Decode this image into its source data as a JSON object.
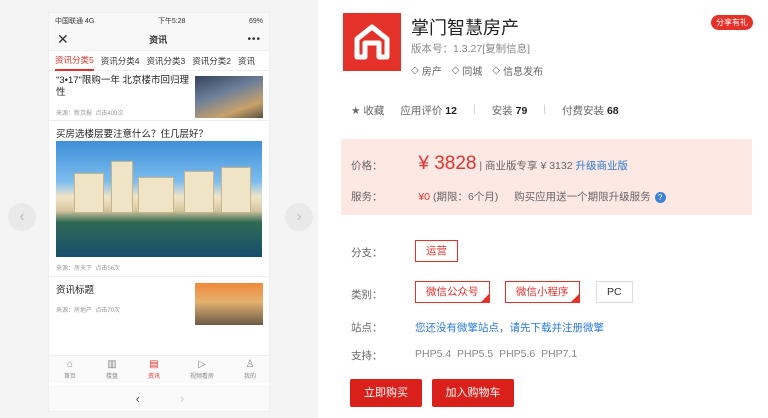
{
  "phone": {
    "status": {
      "carrier": "中国联通 4G",
      "time": "下午5:28",
      "battery": "69%"
    },
    "title": "资讯",
    "tabs": [
      "资讯分类5",
      "资讯分类4",
      "资讯分类3",
      "资讯分类2",
      "资讯"
    ],
    "news": [
      {
        "title": "\"3•17\"限购一年 北京楼市回归理性",
        "source": "来源：新京报",
        "clicks": "点击409次"
      },
      {
        "title": "买房选楼层要注意什么？住几层好？",
        "source": "来源：房天下",
        "clicks": "点击56次"
      },
      {
        "title": "资讯标题",
        "source": "来源：房地产",
        "clicks": "点击70次"
      }
    ],
    "tabbar": [
      {
        "label": "首页",
        "icon": "home-icon"
      },
      {
        "label": "楼盘",
        "icon": "building-icon"
      },
      {
        "label": "资讯",
        "icon": "news-icon"
      },
      {
        "label": "视频看房",
        "icon": "play-icon"
      },
      {
        "label": "我的",
        "icon": "user-icon"
      }
    ],
    "nav": {
      "back": "‹",
      "forward": "›"
    }
  },
  "app": {
    "name": "掌门智慧房产",
    "version": "版本号：1.3.27",
    "copy": "[复制信息]",
    "tags": [
      "房产",
      "同城",
      "信息发布"
    ],
    "share": "分享有礼",
    "stats": {
      "fav": "收藏",
      "rating_label": "应用评价",
      "rating": "12",
      "install_label": "安装",
      "install": "79",
      "paid_label": "付费安装",
      "paid": "68"
    },
    "price_label": "价格：",
    "price": "¥ 3828",
    "biz_text": "| 商业版专享 ¥ 3132",
    "upgrade": "升级商业版",
    "service_label": "服务：",
    "service_price": "¥0",
    "service_period": "(期限：6个月)",
    "service_note": "购买应用送一个期限升级服务",
    "branch_label": "分支：",
    "branch": "运营",
    "category_label": "类别：",
    "categories": [
      "微信公众号",
      "微信小程序",
      "PC"
    ],
    "site_label": "站点：",
    "site_text": "您还没有微擎站点，请先下载并注册微擎",
    "support_label": "支持：",
    "support": [
      "PHP5.4",
      "PHP5.5",
      "PHP5.6",
      "PHP7.1"
    ],
    "buy_now": "立即购买",
    "add_cart": "加入购物车"
  }
}
